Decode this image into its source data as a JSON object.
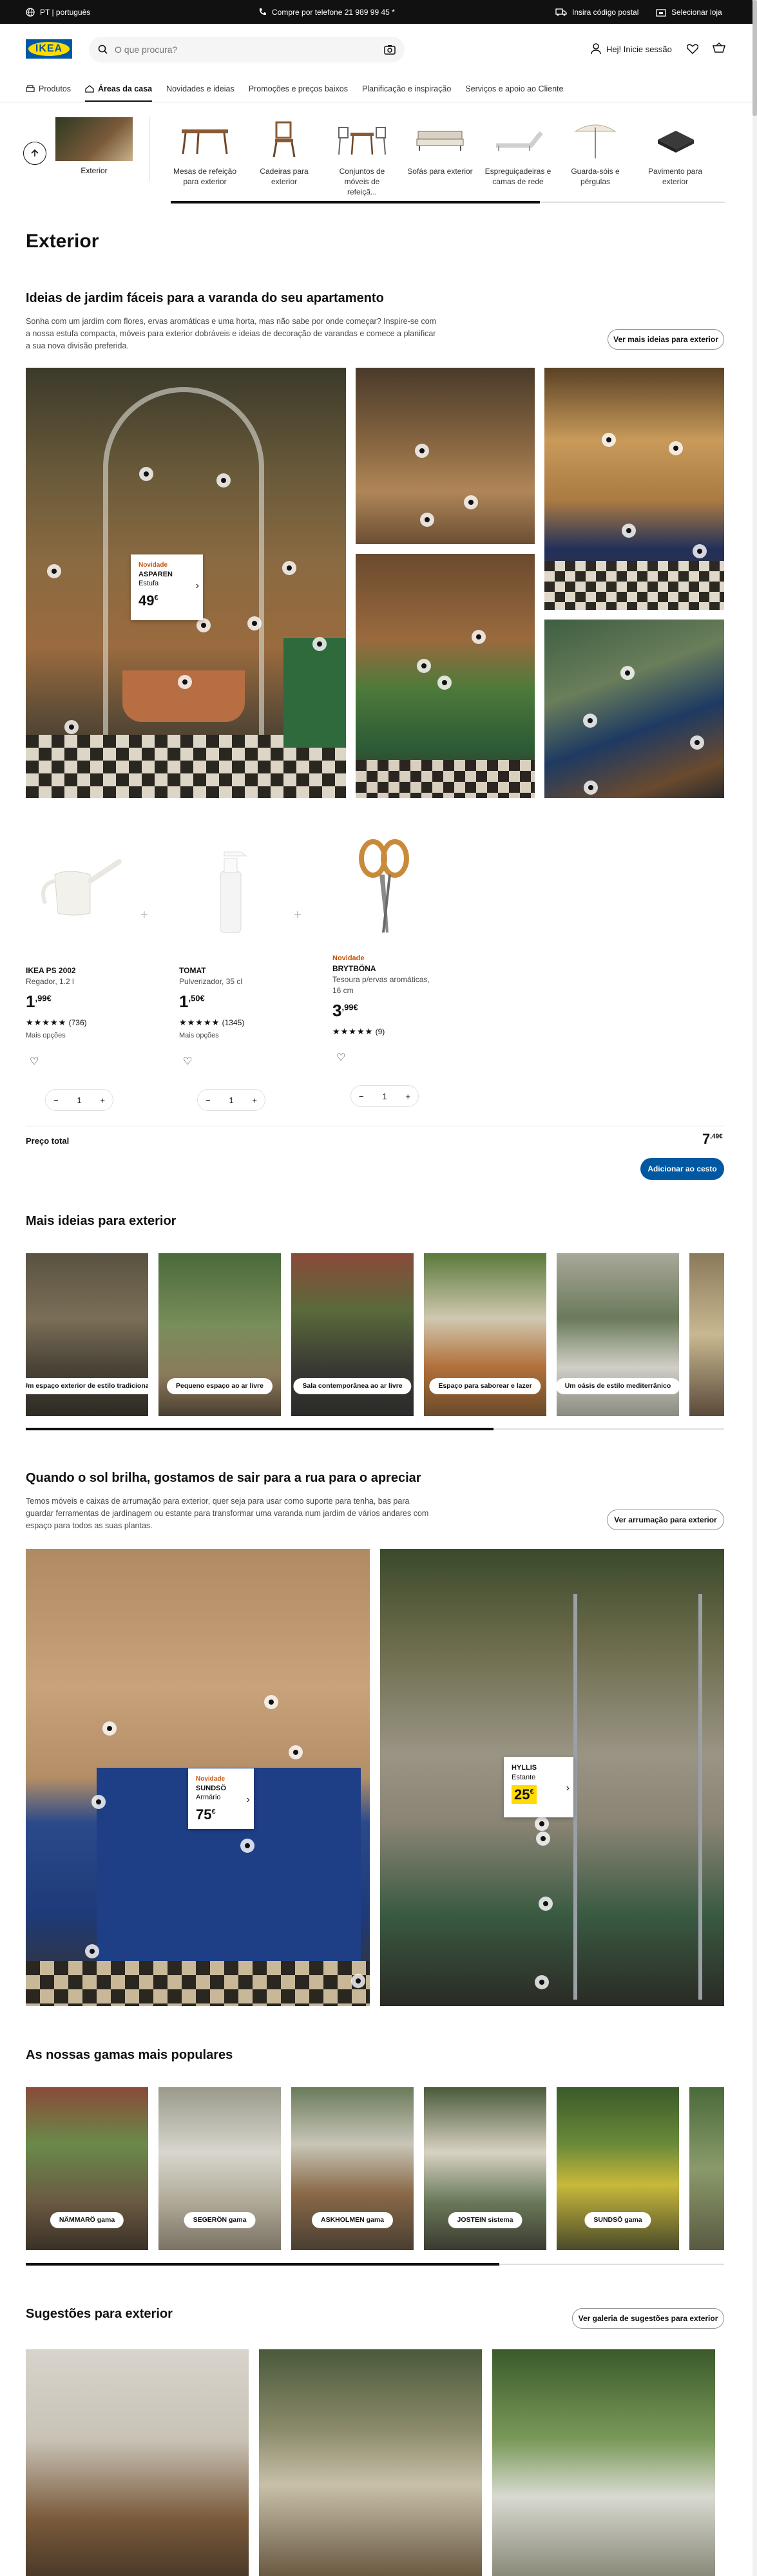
{
  "topbar": {
    "lang": "PT | português",
    "phone": "Compre por telefone 21 989 99 45 *",
    "postal": "Insira código postal",
    "store": "Selecionar loja"
  },
  "header": {
    "logo": "IKEA",
    "search_placeholder": "O que procura?",
    "login": "Hej! Inicie sessão"
  },
  "nav": [
    "Produtos",
    "Áreas da casa",
    "Novidades e ideias",
    "Promoções e preços baixos",
    "Planificação e inspiração",
    "Serviços e apoio ao Cliente"
  ],
  "categories": {
    "current": "Exterior",
    "items": [
      "Mesas de refeição para exterior",
      "Cadeiras para exterior",
      "Conjuntos de móveis de refeiçã...",
      "Sofás para exterior",
      "Espreguiçadeiras e camas de rede",
      "Guarda-sóis e pérgulas",
      "Pavimento para exterior"
    ]
  },
  "page_title": "Exterior",
  "section1": {
    "title": "Ideias de jardim fáceis para a varanda do seu apartamento",
    "desc": "Sonha com um jardim com flores, ervas aromáticas e uma horta, mas não sabe por onde começar? Inspire-se com a nossa estufa compacta, móveis para exterior dobráveis e ideias de decoração de varandas e comece a planificar a sua nova divisão preferida.",
    "button": "Ver mais ideias para exterior",
    "card": {
      "badge": "Novidade",
      "name": "ASPAREN",
      "type": "Estufa",
      "price": "49",
      "cur": "€"
    }
  },
  "products": [
    {
      "badge": "",
      "name": "IKEA PS 2002",
      "desc": "Regador, 1.2 l",
      "price": "1",
      "dec": ",99€",
      "rating": "★★★★★",
      "reviews": "(736)",
      "more": "Mais opções",
      "qty": "1"
    },
    {
      "badge": "",
      "name": "TOMAT",
      "desc": "Pulverizador, 35 cl",
      "price": "1",
      "dec": ",50€",
      "rating": "★★★★★",
      "reviews": "(1345)",
      "more": "Mais opções",
      "qty": "1"
    },
    {
      "badge": "Novidade",
      "name": "BRYTBÖNA",
      "desc": "Tesoura p/ervas aromáticas, 16 cm",
      "price": "3",
      "dec": ",99€",
      "rating": "★★★★★",
      "reviews": "(9)",
      "more": "",
      "qty": "1"
    }
  ],
  "total": {
    "label": "Preço total",
    "value": "7",
    "dec": ",49€",
    "button": "Adicionar ao cesto"
  },
  "section2": {
    "title": "Mais ideias para exterior",
    "tiles": [
      "Um espaço exterior de estilo tradicional",
      "Pequeno espaço ao ar livre",
      "Sala contemporânea ao ar livre",
      "Espaço para saborear e lazer",
      "Um oásis de estilo mediterrânico"
    ]
  },
  "section3": {
    "title": "Quando o sol brilha, gostamos de sair para a rua para o apreciar",
    "desc": "Temos móveis e caixas de arrumação para exterior, quer seja para usar como suporte para tenha, bas para guardar ferramentas de jardinagem ou estante para transformar uma varanda num jardim de vários andares com espaço para todos as suas plantas.",
    "button": "Ver arrumação para exterior",
    "card1": {
      "badge": "Novidade",
      "name": "SUNDSÖ",
      "type": "Armário",
      "price": "75",
      "cur": "€"
    },
    "card2": {
      "name": "HYLLIS",
      "type": "Estante",
      "price": "25",
      "cur": "€"
    }
  },
  "section4": {
    "title": "As nossas gamas mais populares",
    "tiles": [
      "NÄMMARÖ gama",
      "SEGERÖN gama",
      "ASKHOLMEN gama",
      "JOSTEIN sistema",
      "SUNDSÖ gama"
    ]
  },
  "section5": {
    "title": "Sugestões para exterior",
    "button": "Ver galeria de sugestões para exterior"
  },
  "colors": {
    "ikea_blue": "#0058a3",
    "ikea_yellow": "#ffdb00",
    "new_badge": "#ca5008"
  }
}
